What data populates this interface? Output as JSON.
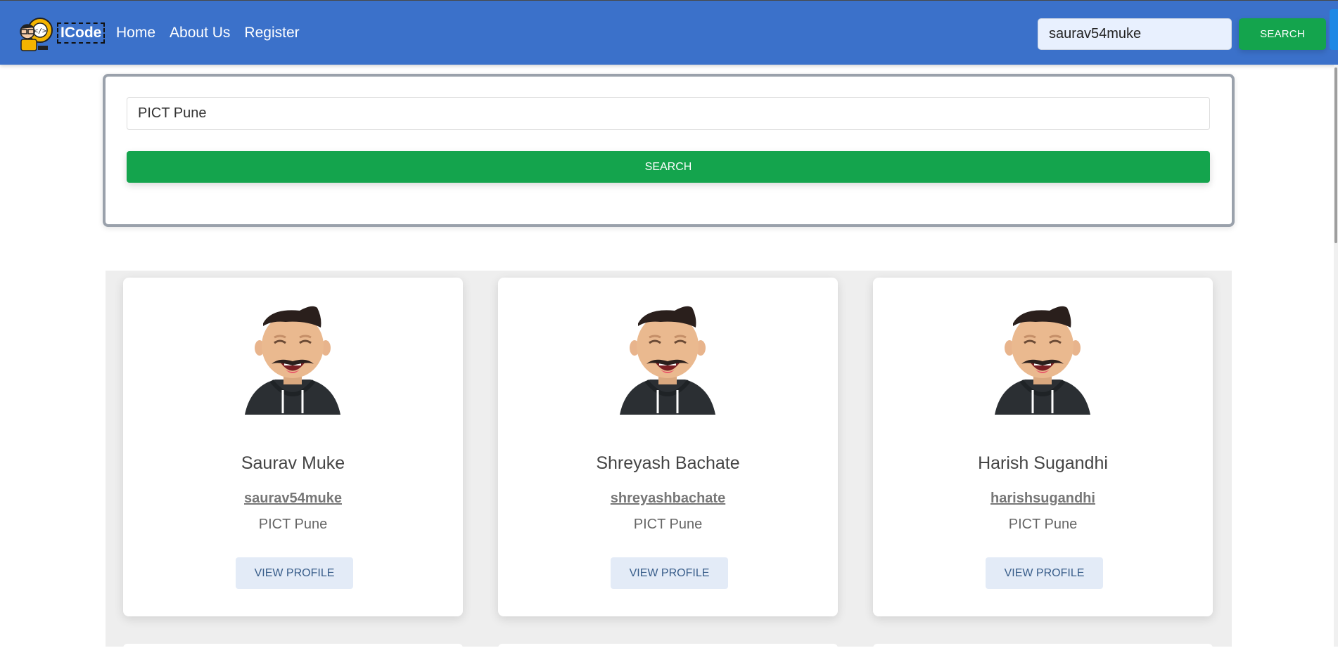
{
  "navbar": {
    "brand": "ICode",
    "links": [
      "Home",
      "About Us",
      "Register"
    ],
    "search_value": "saurav54muke",
    "search_button": "SEARCH"
  },
  "college_search": {
    "value": "PICT Pune",
    "button": "SEARCH"
  },
  "results": [
    {
      "name": "Saurav Muke",
      "handle": "saurav54muke",
      "college": "PICT Pune",
      "button": "VIEW PROFILE"
    },
    {
      "name": "Shreyash Bachate",
      "handle": "shreyashbachate",
      "college": "PICT Pune",
      "button": "VIEW PROFILE"
    },
    {
      "name": "Harish Sugandhi",
      "handle": "harishsugandhi",
      "college": "PICT Pune",
      "button": "VIEW PROFILE"
    }
  ],
  "colors": {
    "navbar": "#3b71ca",
    "success": "#14a44d",
    "view_button_bg": "#e3ebf7"
  },
  "icons": [
    "logo-icon",
    "avatar-icon"
  ]
}
